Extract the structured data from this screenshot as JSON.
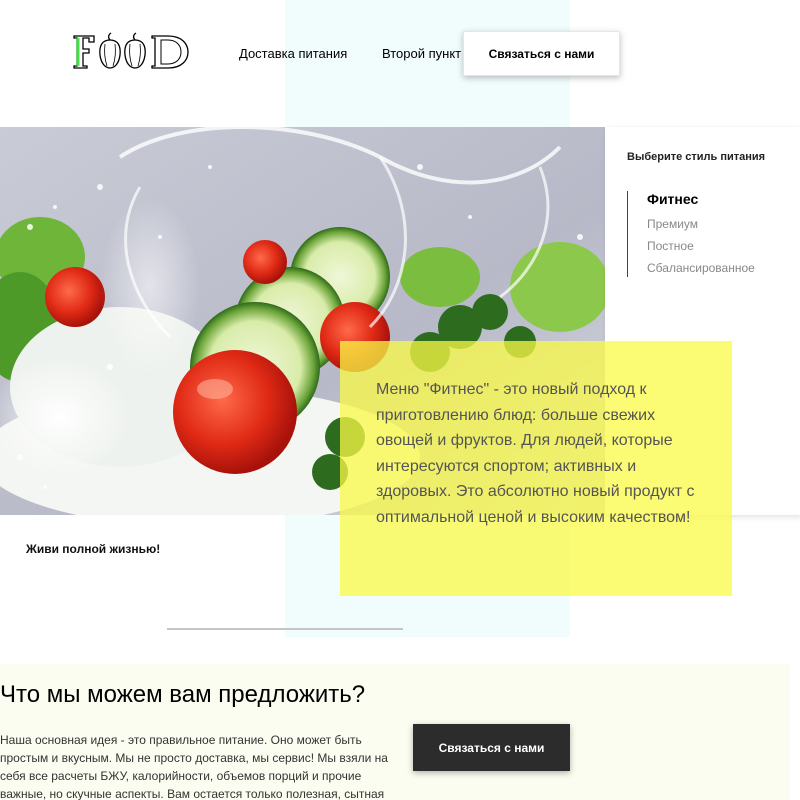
{
  "header": {
    "logo_text": "FOOD",
    "nav": [
      {
        "label": "Доставка питания"
      },
      {
        "label": "Второй пункт"
      }
    ],
    "contact_label": "Связаться с нами"
  },
  "hero": {
    "image_alt": "vegetables-splash-image",
    "panel": {
      "title": "Выберите стиль питания",
      "styles": [
        {
          "label": "Фитнес",
          "active": true
        },
        {
          "label": "Премиум",
          "active": false
        },
        {
          "label": "Постное",
          "active": false
        },
        {
          "label": "Сбалансированное",
          "active": false
        }
      ]
    },
    "description": "Меню \"Фитнес\" - это новый подход к приготовлению блюд: больше свежих овощей и фруктов. Для людей, которые интересуются спортом; активных и здоровых. Это абсолютно новый продукт с оптимальной ценой и высоким качеством!",
    "tagline": "Живи полной жизнью!"
  },
  "offer": {
    "title": "Что мы можем вам предложить?",
    "text": "Наша основная идея - это правильное питание. Оно может быть простым и вкусным. Мы не просто доставка, мы сервис! Мы взяли на себя все расчеты БЖУ, калорийности, объемов порций и прочие важные, но скучные аспекты. Вам остается только полезная, сытная",
    "contact_label": "Связаться с нами"
  },
  "colors": {
    "accent_green": "#3ee13e",
    "yellow": "#fafa46",
    "dark_button": "#2c2c2c",
    "stripe": "#f1fcfd"
  }
}
